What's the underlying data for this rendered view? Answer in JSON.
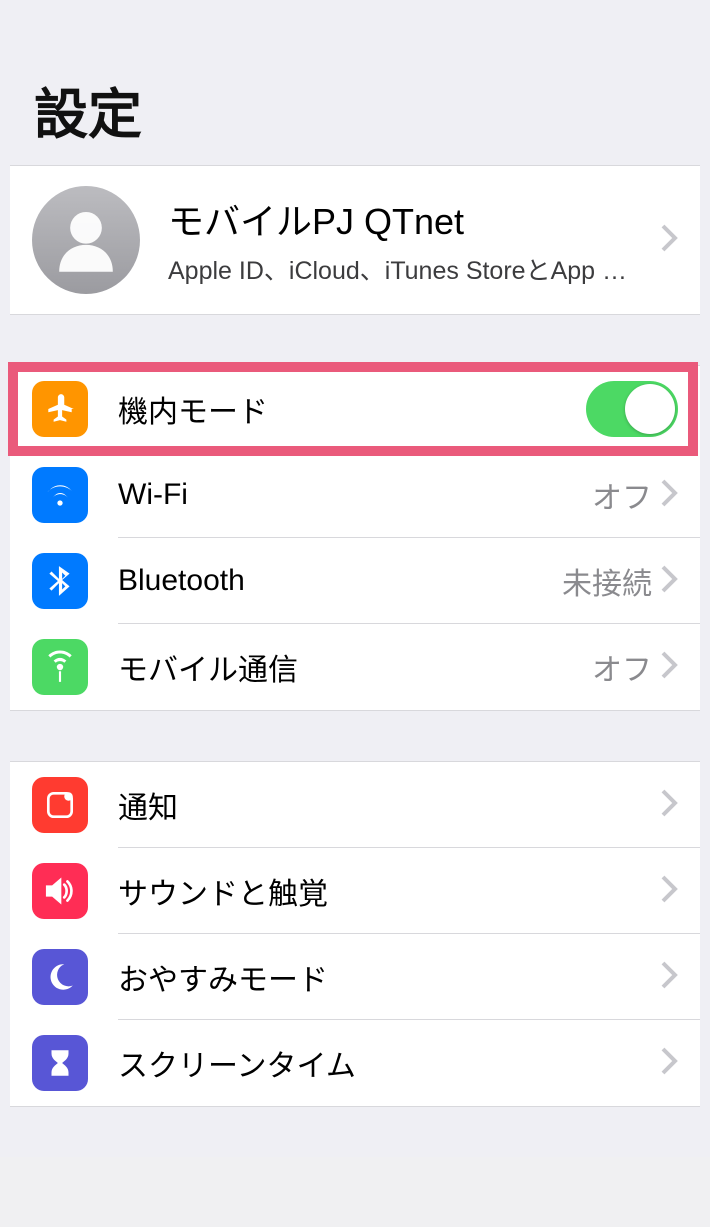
{
  "title": "設定",
  "profile": {
    "name": "モバイルPJ QTnet",
    "subtitle": "Apple ID、iCloud、iTunes StoreとApp S..."
  },
  "group1": {
    "airplane": {
      "label": "機内モード",
      "toggle_on": true
    },
    "wifi": {
      "label": "Wi-Fi",
      "value": "オフ"
    },
    "bluetooth": {
      "label": "Bluetooth",
      "value": "未接続"
    },
    "cellular": {
      "label": "モバイル通信",
      "value": "オフ"
    }
  },
  "group2": {
    "notifications": {
      "label": "通知"
    },
    "sound": {
      "label": "サウンドと触覚"
    },
    "dnd": {
      "label": "おやすみモード"
    },
    "screentime": {
      "label": "スクリーンタイム"
    }
  }
}
